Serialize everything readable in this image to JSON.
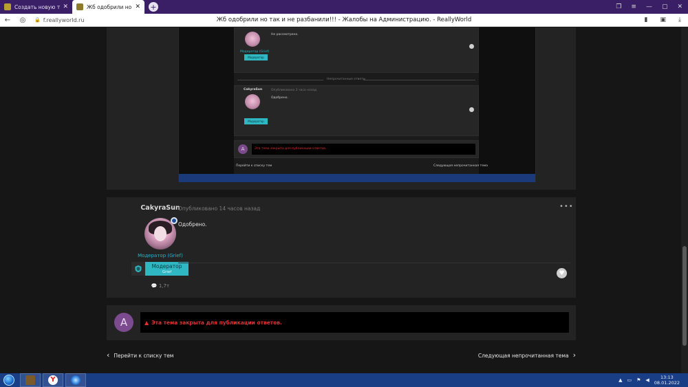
{
  "browser": {
    "tabs": [
      {
        "title": "Создать новую тему - Rea",
        "active": false
      },
      {
        "title": "Жб одобрили но так и н",
        "active": true
      }
    ],
    "new_tab_symbol": "+",
    "url": "f.reallyworld.ru",
    "page_title": "Жб одобрили но так и не разбанили!!! - Жалобы на Администрацию. - ReallyWorld"
  },
  "screenshot_embed": {
    "top_text": "Не рассмотрено.",
    "top_author_role": "Модератор (Grief)",
    "top_badge": "Модератор",
    "unread_label": "Непрочитанные ответы",
    "author": "CakyraSun",
    "posted": "Опубликовано 2 часа назад",
    "body": "Одобрено.",
    "closed_text": "Эта тема закрыта для публикации ответов.",
    "prev": "Перейти к списку тем",
    "next": "Следующая непрочитанная тема"
  },
  "post": {
    "author": "CakyraSun",
    "posted": "Опубликовано 14 часов назад",
    "more": "•••",
    "body": "Одобрено.",
    "role": "Модератор (Grief)",
    "badge_title": "Модератор",
    "badge_sub": "Grief",
    "reputation": "1,7т",
    "online_indicator": "1"
  },
  "reply": {
    "avatar_letter": "A",
    "closed_message": "Эта тема закрыта для публикации ответов."
  },
  "pager": {
    "prev_label": "Перейти к списку тем",
    "next_label": "Следующая непрочитанная тема"
  },
  "taskbar": {
    "time": "13:13",
    "date": "08.01.2022"
  },
  "colors": {
    "accent": "#2fb8c3",
    "warning": "#e03030",
    "background": "#161616",
    "panel": "#232323"
  }
}
